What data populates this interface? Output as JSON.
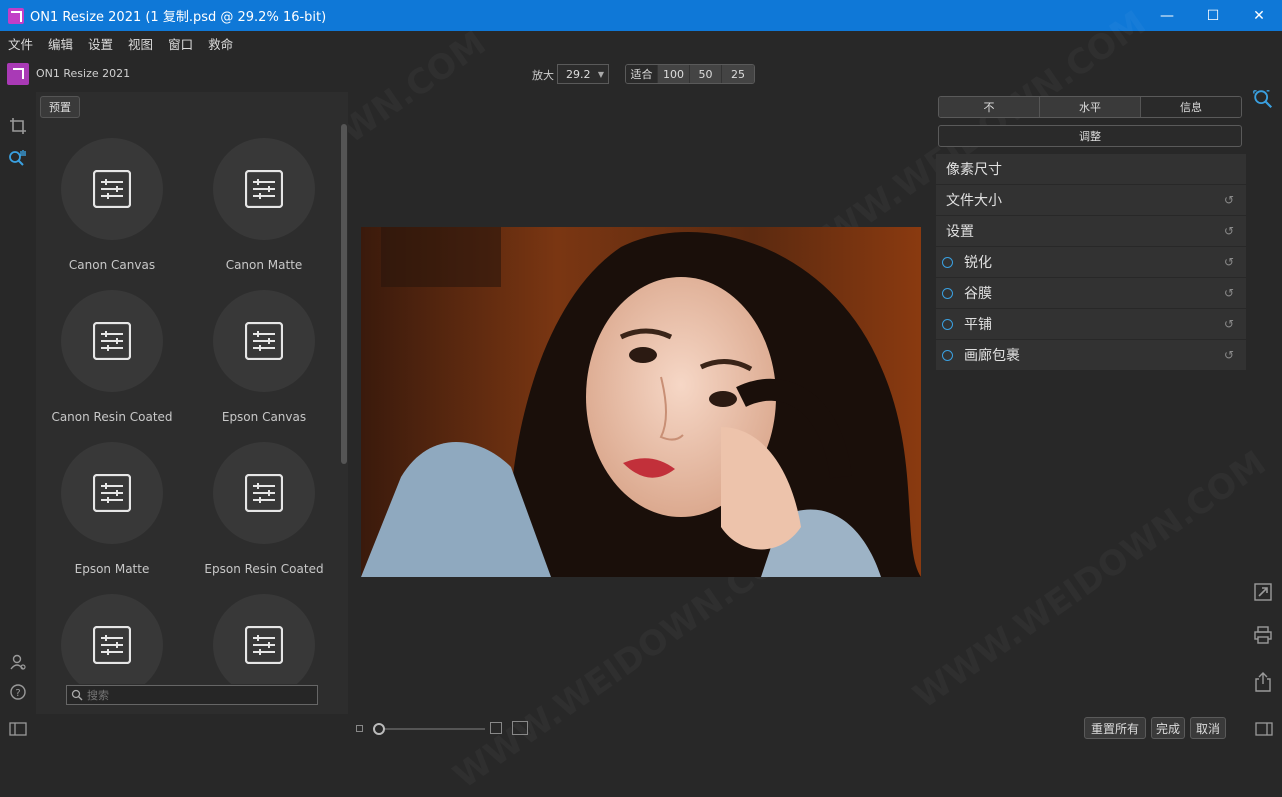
{
  "window": {
    "title": "ON1 Resize 2021 (1 复制.psd @ 29.2% 16-bit)",
    "minimize": "—",
    "maximize": "☐",
    "close": "✕"
  },
  "menu": {
    "items": [
      "文件",
      "编辑",
      "设置",
      "视图",
      "窗口",
      "救命"
    ]
  },
  "brand": {
    "name": "ON1 Resize 2021"
  },
  "left_panel": {
    "preset_label": "预置",
    "presets": [
      "Canon Canvas",
      "Canon Matte",
      "Canon Resin Coated",
      "Epson Canvas",
      "Epson Matte",
      "Epson Resin Coated",
      "",
      ""
    ],
    "search_placeholder": "搜索"
  },
  "toolbar": {
    "zoom_label": "放大",
    "zoom_value": "29.2",
    "zoom_buttons": [
      "适合",
      "100",
      "50",
      "25"
    ]
  },
  "right_panel": {
    "segments": [
      "不",
      "水平",
      "信息"
    ],
    "adjust_label": "调整",
    "rows": [
      {
        "label": "像素尺寸",
        "ring": false,
        "reset": false
      },
      {
        "label": "文件大小",
        "ring": false,
        "reset": true
      },
      {
        "label": "设置",
        "ring": false,
        "reset": true
      },
      {
        "label": "锐化",
        "ring": true,
        "reset": true
      },
      {
        "label": "谷膜",
        "ring": true,
        "reset": true
      },
      {
        "label": "平铺",
        "ring": true,
        "reset": true
      },
      {
        "label": "画廊包裹",
        "ring": true,
        "reset": true
      }
    ]
  },
  "bottom": {
    "reset_all": "重置所有",
    "done": "完成",
    "cancel": "取消"
  },
  "colors": {
    "titlebar": "#0f78d7",
    "background": "#282828",
    "accent_ring": "#3aa0e0",
    "brand": "#a93ab6"
  }
}
